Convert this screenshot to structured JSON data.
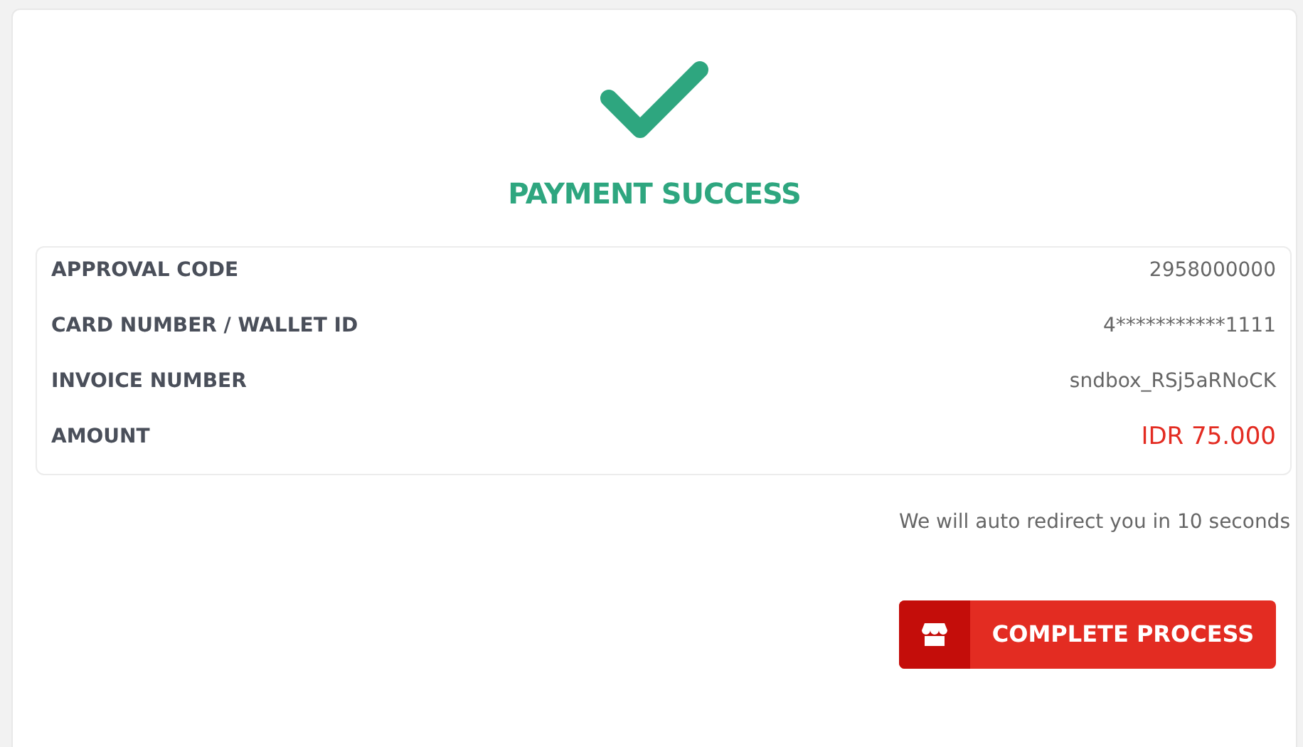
{
  "status": {
    "title": "PAYMENT SUCCESS"
  },
  "details": [
    {
      "label": "APPROVAL CODE",
      "value": "2958000000",
      "kind": "text"
    },
    {
      "label": "CARD NUMBER / WALLET ID",
      "value": "4***********1111",
      "kind": "text"
    },
    {
      "label": "INVOICE NUMBER",
      "value": "sndbox_RSj5aRNoCK",
      "kind": "text"
    },
    {
      "label": "AMOUNT",
      "value": "IDR 75.000",
      "kind": "amount"
    }
  ],
  "redirect_note": "We will auto redirect you in 10 seconds",
  "button": {
    "label": "COMPLETE PROCESS"
  }
}
